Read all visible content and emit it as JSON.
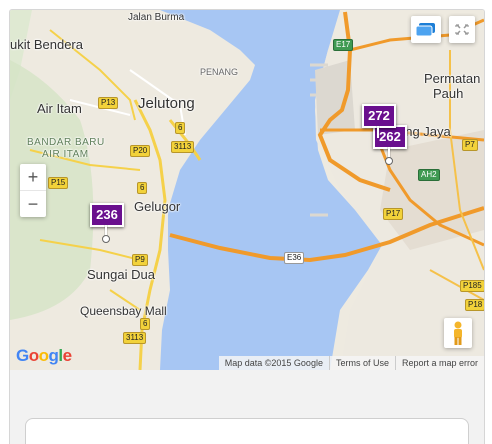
{
  "map": {
    "places": {
      "bukit_bendera": "ukit Bendera",
      "jalan_burma": "Jalan Burma",
      "penang": "PENANG",
      "air_itam": "Air Itam",
      "jelutong": "Jelutong",
      "bandar_baru": "BANDAR BARU",
      "air_itam_caps": "AIR ITAM",
      "gelugor": "Gelugor",
      "sungai_dua": "Sungai Dua",
      "queensbay": "Queensbay Mall",
      "permatang_pauh_1": "Permatan",
      "permatang_pauh_2": "Pauh",
      "seberang_jaya": "ang Jaya"
    },
    "shields": {
      "e17": "E17",
      "p13": "P13",
      "r6_top": "6",
      "r3113_a": "3113",
      "r3113_b": "3113",
      "r6_mid": "6",
      "p20": "P20",
      "p15": "P15",
      "p9": "P9",
      "r6_bottom": "6",
      "e36": "E36",
      "ah2": "AH2",
      "p17": "P17",
      "p7": "P7",
      "p185": "P185",
      "p18": "P18"
    },
    "markers": [
      {
        "count": "236"
      },
      {
        "count": "272"
      },
      {
        "count": "262"
      }
    ],
    "controls": {
      "zoom_in": "+",
      "zoom_out": "−"
    },
    "attribution": {
      "map_data": "Map data ©2015 Google",
      "terms": "Terms of Use",
      "report": "Report a map error"
    },
    "logo": {
      "g1": "G",
      "o1": "o",
      "o2": "o",
      "g2": "g",
      "l": "l",
      "e": "e"
    }
  }
}
